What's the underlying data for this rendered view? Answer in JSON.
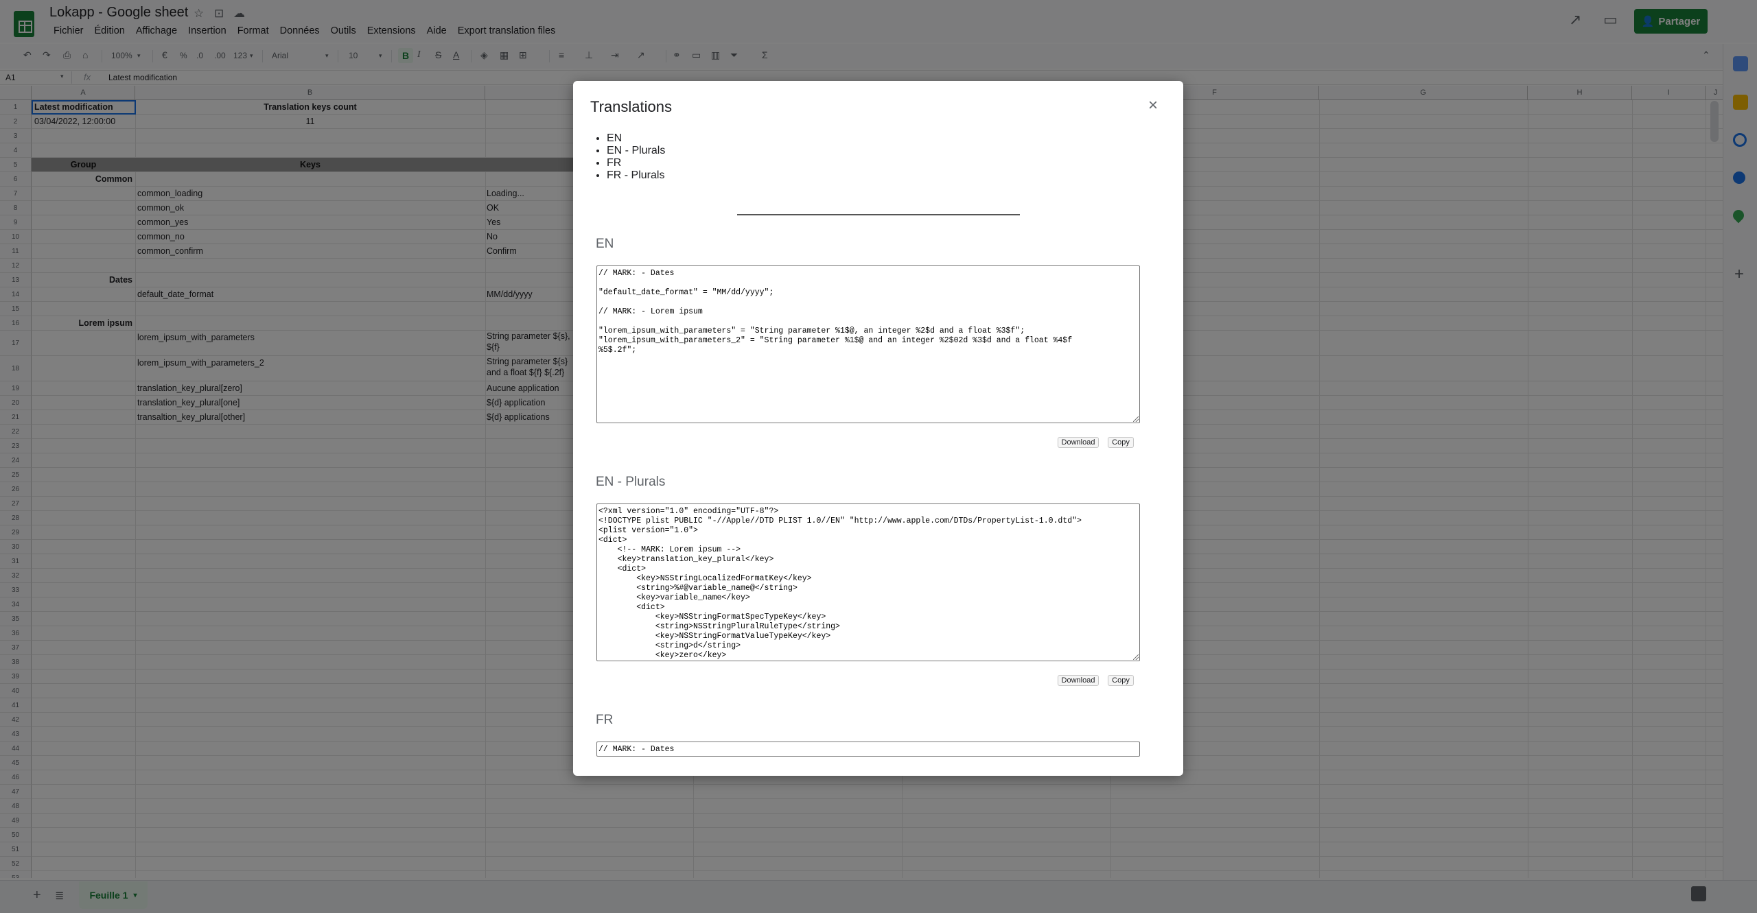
{
  "app": {
    "doc_title": "Lokapp - Google sheet",
    "share_label": "Partager",
    "menu": [
      "Fichier",
      "Édition",
      "Affichage",
      "Insertion",
      "Format",
      "Données",
      "Outils",
      "Extensions",
      "Aide",
      "Export translation files"
    ]
  },
  "toolbar": {
    "zoom": "100%",
    "currency": "€",
    "percent": "%",
    "dec_less": ".0",
    "dec_more": ".00",
    "number_format": "123",
    "font": "Arial",
    "font_size": "10",
    "bold": "B",
    "italic": "I",
    "strike": "S",
    "text_color": "A"
  },
  "formula_bar": {
    "cell_ref": "A1",
    "content": "Latest modification"
  },
  "grid": {
    "columns": [
      "A",
      "B",
      "C",
      "D",
      "E",
      "F",
      "G",
      "H",
      "I",
      "J"
    ],
    "rows": [
      "1",
      "2",
      "3",
      "4",
      "5",
      "6",
      "7",
      "8",
      "9",
      "10",
      "11",
      "12",
      "13",
      "14",
      "15",
      "16",
      "17",
      "18",
      "19",
      "20",
      "21",
      "22",
      "23",
      "24",
      "25",
      "26",
      "27",
      "28",
      "29",
      "30",
      "31",
      "32",
      "33",
      "34",
      "35",
      "36",
      "37",
      "38",
      "39",
      "40",
      "41",
      "42",
      "43",
      "44",
      "45",
      "46",
      "47",
      "48",
      "49",
      "50",
      "51",
      "52",
      "53"
    ],
    "cells": {
      "a1": "Latest modification",
      "b1": "Translation keys count",
      "a2": "03/04/2022, 12:00:00",
      "b2": "11",
      "group_header": "Group",
      "keys_header": "Keys",
      "common": "Common",
      "dates": "Dates",
      "lorem": "Lorem ipsum",
      "k7": "common_loading",
      "v7": "Loading...",
      "k8": "common_ok",
      "v8": "OK",
      "k9": "common_yes",
      "v9": "Yes",
      "k10": "common_no",
      "v10": "No",
      "k11": "common_confirm",
      "v11": "Confirm",
      "k14": "default_date_format",
      "v14": "MM/dd/yyyy",
      "k17": "lorem_ipsum_with_parameters",
      "v17a": "String parameter ${s},",
      "v17b": "${f}",
      "k18": "lorem_ipsum_with_parameters_2",
      "v18a": "String parameter ${s}",
      "v18b": "and a float ${f} ${.2f}",
      "k19": "translation_key_plural[zero]",
      "v19": "Aucune application",
      "k20": "translation_key_plural[one]",
      "v20": "${d} application",
      "k21": "transaltion_key_plural[other]",
      "v21": "${d} applications"
    }
  },
  "sheet_tab": "Feuille 1",
  "dialog": {
    "title": "Translations",
    "close": "×",
    "toc": [
      "EN",
      "EN - Plurals",
      "FR",
      "FR - Plurals"
    ],
    "sections": [
      {
        "heading": "EN",
        "content": "// MARK: - Dates\n\n\"default_date_format\" = \"MM/dd/yyyy\";\n\n// MARK: - Lorem ipsum\n\n\"lorem_ipsum_with_parameters\" = \"String parameter %1$@, an integer %2$d and a float %3$f\";\n\"lorem_ipsum_with_parameters_2\" = \"String parameter %1$@ and an integer %2$02d %3$d and a float %4$f\n%5$.2f\";",
        "download": "Download",
        "copy": "Copy"
      },
      {
        "heading": "EN - Plurals",
        "content": "<?xml version=\"1.0\" encoding=\"UTF-8\"?>\n<!DOCTYPE plist PUBLIC \"-//Apple//DTD PLIST 1.0//EN\" \"http://www.apple.com/DTDs/PropertyList-1.0.dtd\">\n<plist version=\"1.0\">\n<dict>\n    <!-- MARK: Lorem ipsum -->\n    <key>translation_key_plural</key>\n    <dict>\n        <key>NSStringLocalizedFormatKey</key>\n        <string>%#@variable_name@</string>\n        <key>variable_name</key>\n        <dict>\n            <key>NSStringFormatSpecTypeKey</key>\n            <string>NSStringPluralRuleType</string>\n            <key>NSStringFormatValueTypeKey</key>\n            <string>d</string>\n            <key>zero</key>",
        "download": "Download",
        "copy": "Copy"
      },
      {
        "heading": "FR",
        "content": "// MARK: - Dates"
      }
    ]
  }
}
